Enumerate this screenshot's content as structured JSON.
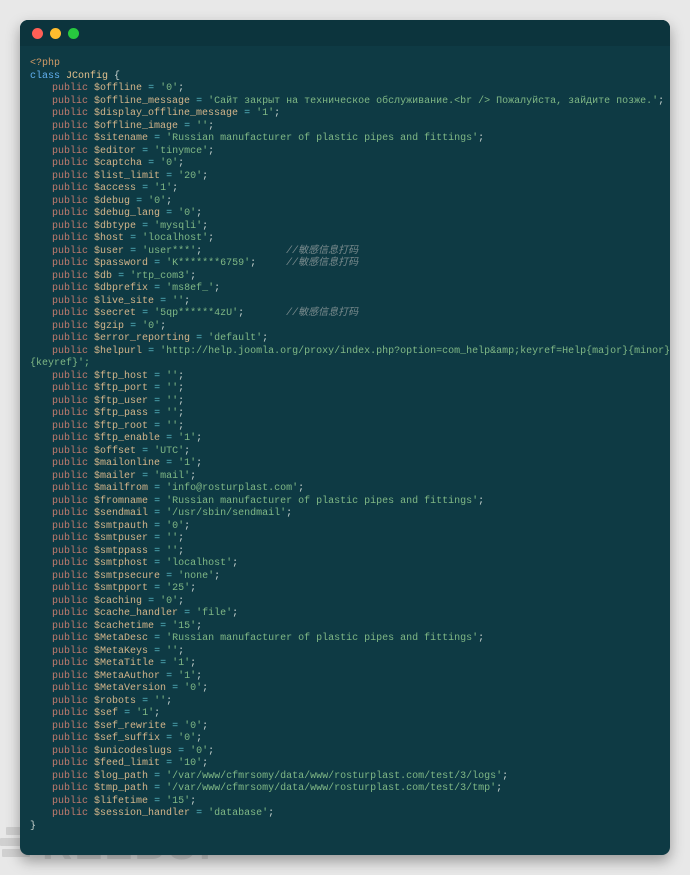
{
  "watermark_text": "REEBUF",
  "php_open": "<?php",
  "class_kw": "class",
  "class_name": "JConfig",
  "keyref_tail": "{keyref}';",
  "close_brace": "}",
  "comments": {
    "user": "//敏感信息打码",
    "password": "//敏感信息打码",
    "secret": "//敏感信息打码"
  },
  "props": [
    {
      "name": "$offline",
      "value": "'0'"
    },
    {
      "name": "$offline_message",
      "value": "'Сайт закрыт на техническое обслуживание.<br /> Пожалуйста, зайдите позже.'"
    },
    {
      "name": "$display_offline_message",
      "value": "'1'"
    },
    {
      "name": "$offline_image",
      "value": "''"
    },
    {
      "name": "$sitename",
      "value": "'Russian manufacturer of plastic pipes and fittings'"
    },
    {
      "name": "$editor",
      "value": "'tinymce'"
    },
    {
      "name": "$captcha",
      "value": "'0'"
    },
    {
      "name": "$list_limit",
      "value": "'20'"
    },
    {
      "name": "$access",
      "value": "'1'"
    },
    {
      "name": "$debug",
      "value": "'0'"
    },
    {
      "name": "$debug_lang",
      "value": "'0'"
    },
    {
      "name": "$dbtype",
      "value": "'mysqli'"
    },
    {
      "name": "$host",
      "value": "'localhost'"
    },
    {
      "name": "$user",
      "value": "'user***'",
      "comment": "user",
      "pad": 14
    },
    {
      "name": "$password",
      "value": "'K*******6759'",
      "comment": "password",
      "pad": 5
    },
    {
      "name": "$db",
      "value": "'rtp_com3'"
    },
    {
      "name": "$dbprefix",
      "value": "'ms8ef_'"
    },
    {
      "name": "$live_site",
      "value": "''"
    },
    {
      "name": "$secret",
      "value": "'5qp******4zU'",
      "comment": "secret",
      "pad": 7
    },
    {
      "name": "$gzip",
      "value": "'0'"
    },
    {
      "name": "$error_reporting",
      "value": "'default'"
    },
    {
      "name": "$helpurl",
      "value": "'http://help.joomla.org/proxy/index.php?option=com_help&amp;keyref=Help{major}{minor}:",
      "noTerm": true
    },
    {
      "name": "$ftp_host",
      "value": "''"
    },
    {
      "name": "$ftp_port",
      "value": "''"
    },
    {
      "name": "$ftp_user",
      "value": "''"
    },
    {
      "name": "$ftp_pass",
      "value": "''"
    },
    {
      "name": "$ftp_root",
      "value": "''"
    },
    {
      "name": "$ftp_enable",
      "value": "'1'"
    },
    {
      "name": "$offset",
      "value": "'UTC'"
    },
    {
      "name": "$mailonline",
      "value": "'1'"
    },
    {
      "name": "$mailer",
      "value": "'mail'"
    },
    {
      "name": "$mailfrom",
      "value": "'info@rosturplast.com'"
    },
    {
      "name": "$fromname",
      "value": "'Russian manufacturer of plastic pipes and fittings'"
    },
    {
      "name": "$sendmail",
      "value": "'/usr/sbin/sendmail'"
    },
    {
      "name": "$smtpauth",
      "value": "'0'"
    },
    {
      "name": "$smtpuser",
      "value": "''"
    },
    {
      "name": "$smtppass",
      "value": "''"
    },
    {
      "name": "$smtphost",
      "value": "'localhost'"
    },
    {
      "name": "$smtpsecure",
      "value": "'none'"
    },
    {
      "name": "$smtpport",
      "value": "'25'"
    },
    {
      "name": "$caching",
      "value": "'0'"
    },
    {
      "name": "$cache_handler",
      "value": "'file'"
    },
    {
      "name": "$cachetime",
      "value": "'15'"
    },
    {
      "name": "$MetaDesc",
      "value": "'Russian manufacturer of plastic pipes and fittings'"
    },
    {
      "name": "$MetaKeys",
      "value": "''"
    },
    {
      "name": "$MetaTitle",
      "value": "'1'"
    },
    {
      "name": "$MetaAuthor",
      "value": "'1'"
    },
    {
      "name": "$MetaVersion",
      "value": "'0'"
    },
    {
      "name": "$robots",
      "value": "''"
    },
    {
      "name": "$sef",
      "value": "'1'"
    },
    {
      "name": "$sef_rewrite",
      "value": "'0'"
    },
    {
      "name": "$sef_suffix",
      "value": "'0'"
    },
    {
      "name": "$unicodeslugs",
      "value": "'0'"
    },
    {
      "name": "$feed_limit",
      "value": "'10'"
    },
    {
      "name": "$log_path",
      "value": "'/var/www/cfmrsomy/data/www/rosturplast.com/test/3/logs'"
    },
    {
      "name": "$tmp_path",
      "value": "'/var/www/cfmrsomy/data/www/rosturplast.com/test/3/tmp'"
    },
    {
      "name": "$lifetime",
      "value": "'15'"
    },
    {
      "name": "$session_handler",
      "value": "'database'"
    }
  ]
}
